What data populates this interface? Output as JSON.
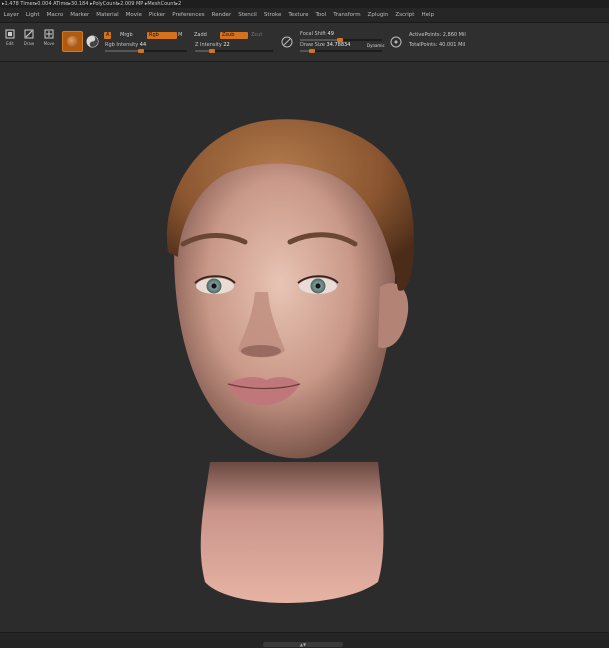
{
  "stats_bar": {
    "text": "▸1.478 Timer▸0.004 ATime▸30.184 ▸PolyCount▸2.009 MP ▸MeshCount▸2"
  },
  "menu": {
    "items": [
      "Layer",
      "Light",
      "Macro",
      "Marker",
      "Material",
      "Movie",
      "Picker",
      "Preferences",
      "Render",
      "Stencil",
      "Stroke",
      "Texture",
      "Tool",
      "Transform",
      "Zplugin",
      "Zscript",
      "Help"
    ]
  },
  "toolbar": {
    "buttons": [
      "Edit",
      "Draw",
      "Move"
    ],
    "a_label": "A",
    "mrgb_label": "Mrgb",
    "rgb_label": "Rgb",
    "m_label": "M",
    "zadd_label": "Zadd",
    "zsub_label": "Zsub",
    "zcut_label": "Zcut",
    "rgb_intensity_label": "Rgb Intensity",
    "rgb_intensity_value": "44",
    "z_intensity_label": "Z Intensity",
    "z_intensity_value": "22",
    "focal_shift_label": "Focal Shift",
    "focal_shift_value": "49",
    "draw_size_label": "Draw Size",
    "draw_size_value": "34.78834",
    "dynamic_label": "Dynamic",
    "active_points_label": "ActivePoints:",
    "active_points_value": "2,860 Mil",
    "total_points_label": "TotalPoints:",
    "total_points_value": "40.001 Mil",
    "rgb_intensity_level": 0.44,
    "z_intensity_level": 0.22,
    "focal_shift_level": 0.49,
    "draw_size_level": 0.15
  },
  "bottom": {
    "handle_label": "▲▼"
  },
  "colors": {
    "accent": "#d6731a",
    "background": "#2c2c2c"
  }
}
